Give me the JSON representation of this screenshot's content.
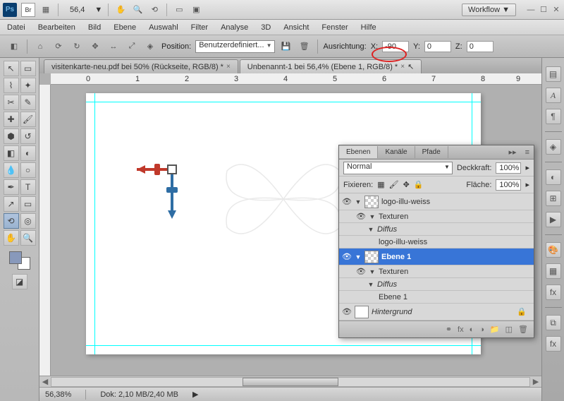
{
  "top": {
    "zoom": "56,4",
    "workflow": "Workflow ▼"
  },
  "menu": {
    "items": [
      "Datei",
      "Bearbeiten",
      "Bild",
      "Ebene",
      "Auswahl",
      "Filter",
      "Analyse",
      "3D",
      "Ansicht",
      "Fenster",
      "Hilfe"
    ]
  },
  "options": {
    "position_label": "Position:",
    "position_value": "Benutzerdefiniert...",
    "orient_label": "Ausrichtung:",
    "x_lbl": "X:",
    "x": "-90",
    "y_lbl": "Y:",
    "y": "0",
    "z_lbl": "Z:",
    "z": "0"
  },
  "tabs": {
    "t1": "visitenkarte-neu.pdf bei 50% (Rückseite, RGB/8) *",
    "t2": "Unbenannt-1 bei 56,4% (Ebene 1, RGB/8) *"
  },
  "ruler": {
    "marks": [
      "0",
      "1",
      "2",
      "3",
      "4",
      "5",
      "6",
      "7",
      "8",
      "9"
    ]
  },
  "status": {
    "zoom": "56,38%",
    "doc": "Dok: 2,10 MB/2,40 MB"
  },
  "layers": {
    "tabs": {
      "ebenen": "Ebenen",
      "kanale": "Kanäle",
      "pfade": "Pfade"
    },
    "blend": "Normal",
    "opacity_lbl": "Deckkraft:",
    "opacity": "100%",
    "lock_lbl": "Fixieren:",
    "fill_lbl": "Fläche:",
    "fill": "100%",
    "items": [
      {
        "name": "logo-illu-weiss"
      },
      {
        "name": "Texturen"
      },
      {
        "name": "Diffus"
      },
      {
        "name": "logo-illu-weiss"
      },
      {
        "name": "Ebene 1"
      },
      {
        "name": "Texturen"
      },
      {
        "name": "Diffus"
      },
      {
        "name": "Ebene 1"
      },
      {
        "name": "Hintergrund"
      }
    ]
  }
}
